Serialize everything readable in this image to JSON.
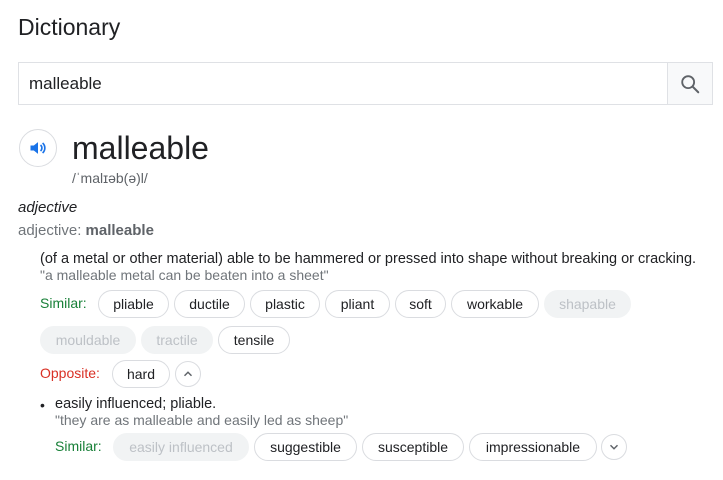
{
  "page": {
    "title": "Dictionary"
  },
  "search": {
    "value": "malleable"
  },
  "entry": {
    "word": "malleable",
    "phonetic": "/ˈmalɪəb(ə)l/",
    "part_of_speech": "adjective",
    "part_of_speech_line_prefix": "adjective: ",
    "part_of_speech_line_word": "malleable"
  },
  "sense1": {
    "definition": "(of a metal or other material) able to be hammered or pressed into shape without breaking or cracking.",
    "example": "\"a malleable metal can be beaten into a sheet\"",
    "similar_label": "Similar:",
    "similar": [
      "pliable",
      "ductile",
      "plastic",
      "pliant",
      "soft",
      "workable",
      "shapable",
      "mouldable",
      "tractile",
      "tensile"
    ],
    "opposite_label": "Opposite:",
    "opposite": [
      "hard"
    ]
  },
  "sense2": {
    "bullet": "•",
    "definition": "easily influenced; pliable.",
    "example": "\"they are as malleable and easily led as sheep\"",
    "similar_label": "Similar:",
    "similar": [
      "easily influenced",
      "suggestible",
      "susceptible",
      "impressionable"
    ]
  },
  "icons": {
    "search": "search-icon",
    "speaker": "speaker-icon",
    "collapse": "chevron-up-icon",
    "expand": "chevron-down-icon"
  },
  "colors": {
    "similar_label": "#188038",
    "opposite_label": "#d93025",
    "speaker": "#1a73e8"
  }
}
